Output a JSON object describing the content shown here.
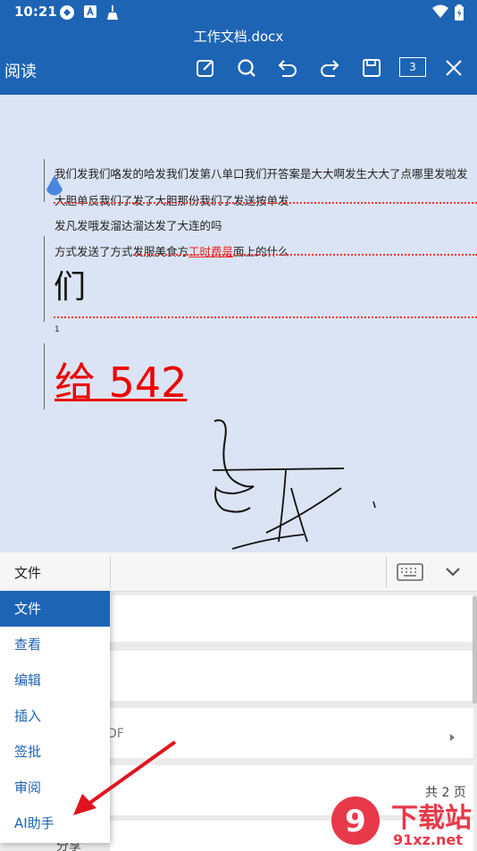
{
  "status": {
    "time": "10:21"
  },
  "title_bar": {
    "doc_title": "工作文档.docx",
    "read_label": "阅读",
    "page_count": "3"
  },
  "document": {
    "lines": [
      "我们发我们咯发的哈发我们发第八单口我们开答案是大大啊发生大大了点哪里发啦发",
      "大胆单反我们了发了大胆那份我们了发送按单发",
      "发凡发哦发溜达溜达发了大连的吗"
    ],
    "line4_prefix": "方式发送了方式发服美食方",
    "line4_red": "工时费是",
    "line4_suffix": "面上的什么",
    "big_char": "们",
    "small_mark": "1",
    "red_big": "给 542"
  },
  "panel": {
    "current_tab": "文件",
    "pdf_suffix": "DF",
    "page_total": "共 2 页",
    "share": "分享"
  },
  "menu": {
    "items": [
      "文件",
      "查看",
      "编辑",
      "插入",
      "签批",
      "审阅",
      "AI助手"
    ]
  },
  "watermark": {
    "brand": "下载站",
    "site": "91xz.net",
    "logo_text": "9"
  },
  "colors": {
    "accent": "#1e64b4",
    "annotation_red": "#e00000"
  }
}
